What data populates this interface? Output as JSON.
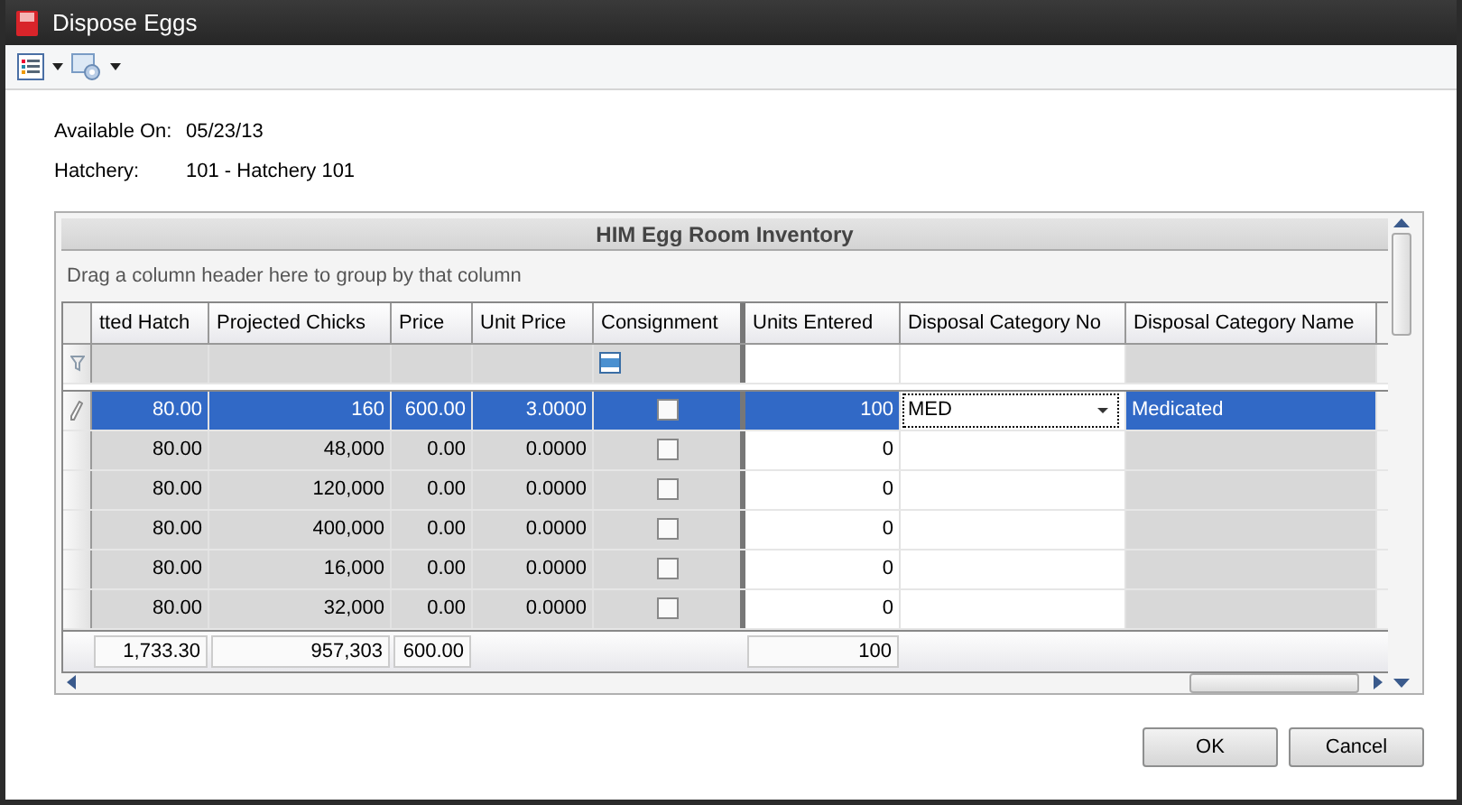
{
  "window": {
    "title": "Dispose Eggs"
  },
  "info": [
    {
      "label": "Available On:",
      "value": "05/23/13"
    },
    {
      "label": "Hatchery:",
      "value": "101 - Hatchery 101"
    }
  ],
  "grid": {
    "title": "HIM Egg Room Inventory",
    "group_hint": "Drag a column header here to group by that column",
    "columns": [
      {
        "label": "tted Hatch",
        "kind": "number",
        "editable": false
      },
      {
        "label": "Projected Chicks",
        "kind": "number",
        "editable": false
      },
      {
        "label": "Price",
        "kind": "number",
        "editable": false
      },
      {
        "label": "Unit Price",
        "kind": "number",
        "editable": false
      },
      {
        "label": "Consignment",
        "kind": "check",
        "editable": false
      },
      {
        "label": "Units Entered",
        "kind": "number",
        "editable": true
      },
      {
        "label": "Disposal Category No",
        "kind": "dropdown",
        "editable": true
      },
      {
        "label": "Disposal Category Name",
        "kind": "text",
        "editable": false
      }
    ],
    "filter_consignment_indeterminate": true,
    "rows": [
      {
        "selected": true,
        "hatch": "80.00",
        "chicks": "160",
        "price": "600.00",
        "unit_price": "3.0000",
        "consignment": false,
        "units": "100",
        "category_no": "MED",
        "category_name": "Medicated"
      },
      {
        "selected": false,
        "hatch": "80.00",
        "chicks": "48,000",
        "price": "0.00",
        "unit_price": "0.0000",
        "consignment": false,
        "units": "0"
      },
      {
        "selected": false,
        "hatch": "80.00",
        "chicks": "120,000",
        "price": "0.00",
        "unit_price": "0.0000",
        "consignment": false,
        "units": "0"
      },
      {
        "selected": false,
        "hatch": "80.00",
        "chicks": "400,000",
        "price": "0.00",
        "unit_price": "0.0000",
        "consignment": false,
        "units": "0"
      },
      {
        "selected": false,
        "hatch": "80.00",
        "chicks": "16,000",
        "price": "0.00",
        "unit_price": "0.0000",
        "consignment": false,
        "units": "0"
      },
      {
        "selected": false,
        "hatch": "80.00",
        "chicks": "32,000",
        "price": "0.00",
        "unit_price": "0.0000",
        "consignment": false,
        "units": "0"
      }
    ],
    "totals": {
      "hatch": "1,733.30",
      "chicks": "957,303",
      "price": "600.00",
      "units": "100"
    }
  },
  "buttons": [
    "OK",
    "Cancel"
  ]
}
